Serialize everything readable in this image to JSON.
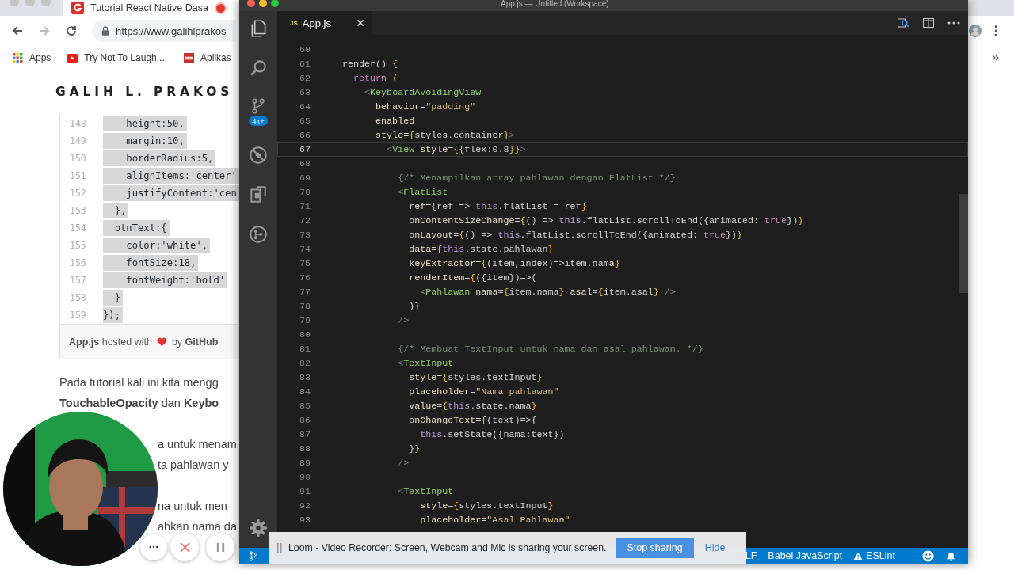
{
  "browser": {
    "tab": {
      "title": "Tutorial React Native Dasa",
      "recording": true
    },
    "address": "https://www.galihlprakos",
    "bookmarks": [
      {
        "kind": "apps",
        "label": "Apps"
      },
      {
        "kind": "video",
        "label": "Try Not To Laugh ..."
      },
      {
        "kind": "app",
        "label": "Aplikas"
      }
    ]
  },
  "page": {
    "site_title": "GALIH L. PRAKOS",
    "gist": {
      "lines": [
        {
          "n": "148",
          "t": "    height:50,"
        },
        {
          "n": "149",
          "t": "    margin:10,"
        },
        {
          "n": "150",
          "t": "    borderRadius:5,"
        },
        {
          "n": "151",
          "t": "    alignItems:'center'"
        },
        {
          "n": "152",
          "t": "    justifyContent:'cen"
        },
        {
          "n": "153",
          "t": "  },"
        },
        {
          "n": "154",
          "t": "  btnText:{"
        },
        {
          "n": "155",
          "t": "    color:'white',"
        },
        {
          "n": "156",
          "t": "    fontSize:18,"
        },
        {
          "n": "157",
          "t": "    fontWeight:'bold'"
        },
        {
          "n": "158",
          "t": "  }"
        },
        {
          "n": "159",
          "t": "});"
        }
      ],
      "footer_left": "**App.js** hosted with",
      "footer_right": "by **GitHub**"
    },
    "paragraphs": [
      [
        "Pada tutorial kali ini kita mengg",
        "**TouchableOpacity** dan **Keybo**"
      ],
      [
        "a untuk menam",
        "ta pahlawan y"
      ],
      [
        "na untuk men",
        "ahkan nama da"
      ]
    ]
  },
  "vscode": {
    "title": "App.js — Untitled (Workspace)",
    "tab": {
      "badge": "JS",
      "name": "App.js"
    },
    "scm_badge": "4k+",
    "lines": [
      {
        "n": "60",
        "current": false
      },
      {
        "n": "61",
        "current": false,
        "tokens": [
          {
            "kind": "p",
            "text": "render() "
          },
          {
            "kind": "br",
            "text": "{"
          }
        ]
      },
      {
        "n": "62",
        "current": false,
        "tokens": [
          {
            "kind": "kw",
            "text": "  return "
          },
          {
            "kind": "br",
            "text": "("
          }
        ]
      },
      {
        "n": "63",
        "current": false,
        "tokens": [
          {
            "kind": "g",
            "text": "    <"
          },
          {
            "kind": "tag",
            "text": "KeyboardAvoidingView"
          }
        ]
      },
      {
        "n": "64",
        "current": false,
        "tokens": [
          {
            "kind": "at",
            "text": "      behavior"
          },
          {
            "kind": "p",
            "text": "="
          },
          {
            "kind": "str",
            "text": "\"padding\""
          }
        ]
      },
      {
        "n": "65",
        "current": false,
        "tokens": [
          {
            "kind": "at",
            "text": "      enabled"
          }
        ]
      },
      {
        "n": "66",
        "current": false,
        "tokens": [
          {
            "kind": "at",
            "text": "      style"
          },
          {
            "kind": "p",
            "text": "="
          },
          {
            "kind": "br",
            "text": "{"
          },
          {
            "kind": "p",
            "text": "styles.container"
          },
          {
            "kind": "br",
            "text": "}"
          },
          {
            "kind": "g",
            "text": ">"
          }
        ]
      },
      {
        "n": "67",
        "current": true,
        "tokens": [
          {
            "kind": "g",
            "text": "        <"
          },
          {
            "kind": "tag",
            "text": "View"
          },
          {
            "kind": "at",
            "text": " style"
          },
          {
            "kind": "p",
            "text": "="
          },
          {
            "kind": "br",
            "text": "{{"
          },
          {
            "kind": "p",
            "text": "flex:0.8"
          },
          {
            "kind": "br",
            "text": "}}"
          },
          {
            "kind": "g",
            "text": ">"
          }
        ]
      },
      {
        "n": "68",
        "current": false
      },
      {
        "n": "69",
        "current": false,
        "tokens": [
          {
            "kind": "cm",
            "text": "          {/* Menampilkan array pahlawan dengan FlatList */}"
          }
        ]
      },
      {
        "n": "70",
        "current": false,
        "tokens": [
          {
            "kind": "g",
            "text": "          <"
          },
          {
            "kind": "tag",
            "text": "FlatList"
          }
        ]
      },
      {
        "n": "71",
        "current": false,
        "tokens": [
          {
            "kind": "at",
            "text": "            ref"
          },
          {
            "kind": "p",
            "text": "="
          },
          {
            "kind": "br",
            "text": "{"
          },
          {
            "kind": "p",
            "text": "ref => "
          },
          {
            "kind": "th",
            "text": "this"
          },
          {
            "kind": "p",
            "text": ".flatList = ref"
          },
          {
            "kind": "br",
            "text": "}"
          }
        ]
      },
      {
        "n": "72",
        "current": false,
        "tokens": [
          {
            "kind": "at",
            "text": "            onContentSizeChange"
          },
          {
            "kind": "p",
            "text": "="
          },
          {
            "kind": "br",
            "text": "{"
          },
          {
            "kind": "p",
            "text": "() => "
          },
          {
            "kind": "th",
            "text": "this"
          },
          {
            "kind": "p",
            "text": ".flatList.scrollToEnd({animated: "
          },
          {
            "kind": "kw",
            "text": "true"
          },
          {
            "kind": "p",
            "text": "})"
          },
          {
            "kind": "br",
            "text": "}"
          }
        ]
      },
      {
        "n": "73",
        "current": false,
        "tokens": [
          {
            "kind": "at",
            "text": "            onLayout"
          },
          {
            "kind": "p",
            "text": "="
          },
          {
            "kind": "br",
            "text": "{"
          },
          {
            "kind": "p",
            "text": "() => "
          },
          {
            "kind": "th",
            "text": "this"
          },
          {
            "kind": "p",
            "text": ".flatList.scrollToEnd({animated: "
          },
          {
            "kind": "kw",
            "text": "true"
          },
          {
            "kind": "p",
            "text": "})"
          },
          {
            "kind": "br",
            "text": "}"
          }
        ]
      },
      {
        "n": "74",
        "current": false,
        "tokens": [
          {
            "kind": "at",
            "text": "            data"
          },
          {
            "kind": "p",
            "text": "="
          },
          {
            "kind": "br",
            "text": "{"
          },
          {
            "kind": "th",
            "text": "this"
          },
          {
            "kind": "p",
            "text": ".state.pahlawan"
          },
          {
            "kind": "br",
            "text": "}"
          }
        ]
      },
      {
        "n": "75",
        "current": false,
        "tokens": [
          {
            "kind": "at",
            "text": "            keyExtractor"
          },
          {
            "kind": "p",
            "text": "="
          },
          {
            "kind": "br",
            "text": "{"
          },
          {
            "kind": "p",
            "text": "(item,index)=>item.nama"
          },
          {
            "kind": "br",
            "text": "}"
          }
        ]
      },
      {
        "n": "76",
        "current": false,
        "tokens": [
          {
            "kind": "at",
            "text": "            renderItem"
          },
          {
            "kind": "p",
            "text": "="
          },
          {
            "kind": "br",
            "text": "{"
          },
          {
            "kind": "p",
            "text": "({item})=>("
          }
        ]
      },
      {
        "n": "77",
        "current": false,
        "tokens": [
          {
            "kind": "g",
            "text": "              <"
          },
          {
            "kind": "tag",
            "text": "Pahlawan"
          },
          {
            "kind": "at",
            "text": " nama"
          },
          {
            "kind": "p",
            "text": "="
          },
          {
            "kind": "br",
            "text": "{"
          },
          {
            "kind": "p",
            "text": "item.nama"
          },
          {
            "kind": "br",
            "text": "}"
          },
          {
            "kind": "at",
            "text": " asal"
          },
          {
            "kind": "p",
            "text": "="
          },
          {
            "kind": "br",
            "text": "{"
          },
          {
            "kind": "p",
            "text": "item.asal"
          },
          {
            "kind": "br",
            "text": "}"
          },
          {
            "kind": "g",
            "text": " />"
          }
        ]
      },
      {
        "n": "78",
        "current": false,
        "tokens": [
          {
            "kind": "p",
            "text": "            )"
          },
          {
            "kind": "br",
            "text": "}"
          }
        ]
      },
      {
        "n": "79",
        "current": false,
        "tokens": [
          {
            "kind": "g",
            "text": "          />"
          }
        ]
      },
      {
        "n": "80",
        "current": false
      },
      {
        "n": "81",
        "current": false,
        "tokens": [
          {
            "kind": "cm",
            "text": "          {/* Membuat TextInput untuk nama dan asal pahlawan. */}"
          }
        ]
      },
      {
        "n": "82",
        "current": false,
        "tokens": [
          {
            "kind": "g",
            "text": "          <"
          },
          {
            "kind": "tag",
            "text": "TextInput"
          }
        ]
      },
      {
        "n": "83",
        "current": false,
        "tokens": [
          {
            "kind": "at",
            "text": "            style"
          },
          {
            "kind": "p",
            "text": "="
          },
          {
            "kind": "br",
            "text": "{"
          },
          {
            "kind": "p",
            "text": "styles.textInput"
          },
          {
            "kind": "br",
            "text": "}"
          }
        ]
      },
      {
        "n": "84",
        "current": false,
        "tokens": [
          {
            "kind": "at",
            "text": "            placeholder"
          },
          {
            "kind": "p",
            "text": "="
          },
          {
            "kind": "str",
            "text": "\"Nama pahlawan\""
          }
        ]
      },
      {
        "n": "85",
        "current": false,
        "tokens": [
          {
            "kind": "at",
            "text": "            value"
          },
          {
            "kind": "p",
            "text": "="
          },
          {
            "kind": "br",
            "text": "{"
          },
          {
            "kind": "th",
            "text": "this"
          },
          {
            "kind": "p",
            "text": ".state.nama"
          },
          {
            "kind": "br",
            "text": "}"
          }
        ]
      },
      {
        "n": "86",
        "current": false,
        "tokens": [
          {
            "kind": "at",
            "text": "            onChangeText"
          },
          {
            "kind": "p",
            "text": "="
          },
          {
            "kind": "br",
            "text": "{"
          },
          {
            "kind": "p",
            "text": "(text)=>{"
          }
        ]
      },
      {
        "n": "87",
        "current": false,
        "tokens": [
          {
            "kind": "th",
            "text": "              this"
          },
          {
            "kind": "p",
            "text": ".setState({nama:text})"
          }
        ]
      },
      {
        "n": "88",
        "current": false,
        "tokens": [
          {
            "kind": "p",
            "text": "            }"
          },
          {
            "kind": "br",
            "text": "}"
          }
        ]
      },
      {
        "n": "89",
        "current": false,
        "tokens": [
          {
            "kind": "g",
            "text": "          />"
          }
        ]
      },
      {
        "n": "90",
        "current": false
      },
      {
        "n": "91",
        "current": false,
        "tokens": [
          {
            "kind": "g",
            "text": "          <"
          },
          {
            "kind": "tag",
            "text": "TextInput"
          }
        ]
      },
      {
        "n": "92",
        "current": false,
        "tokens": [
          {
            "kind": "at",
            "text": "              style"
          },
          {
            "kind": "p",
            "text": "="
          },
          {
            "kind": "br",
            "text": "{"
          },
          {
            "kind": "p",
            "text": "styles.textInput"
          },
          {
            "kind": "br",
            "text": "}"
          }
        ]
      },
      {
        "n": "93",
        "current": false,
        "tokens": [
          {
            "kind": "at",
            "text": "              placeholder"
          },
          {
            "kind": "p",
            "text": "="
          },
          {
            "kind": "str",
            "text": "\"Asal Pahlawan\""
          }
        ]
      }
    ],
    "status": {
      "eol": "LF",
      "language": "Babel JavaScript",
      "linter": "ESLint"
    }
  },
  "loom": {
    "message": "Loom - Video Recorder: Screen, Webcam and Mic is sharing your screen.",
    "stop": "Stop sharing",
    "hide": "Hide"
  }
}
